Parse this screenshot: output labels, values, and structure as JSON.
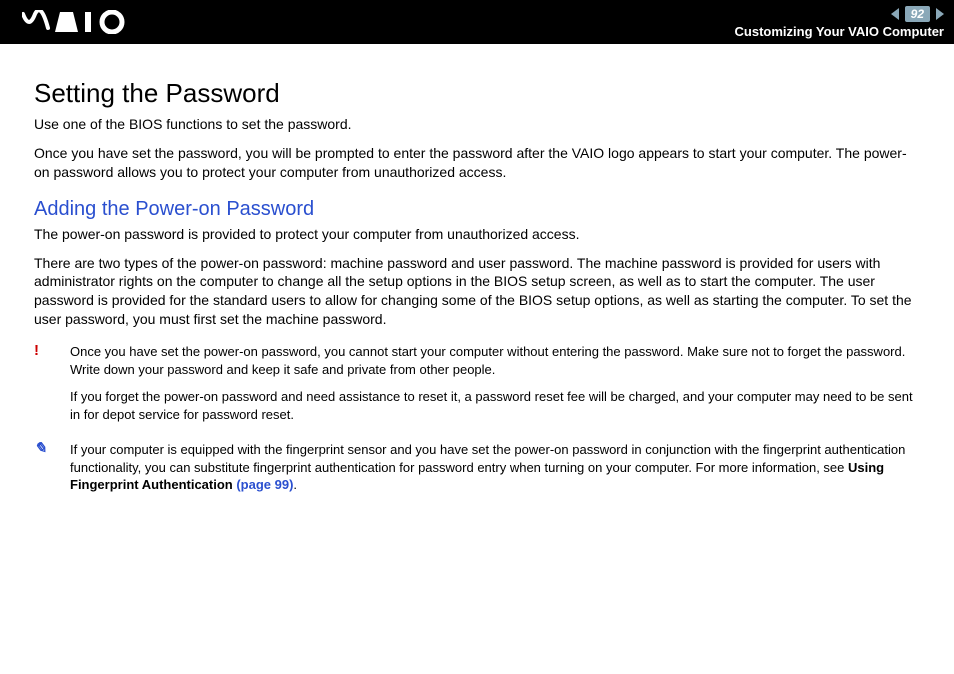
{
  "header": {
    "page_number": "92",
    "breadcrumb": "Customizing Your VAIO Computer"
  },
  "main": {
    "h1": "Setting the Password",
    "intro1": "Use one of the BIOS functions to set the password.",
    "intro2": "Once you have set the password, you will be prompted to enter the password after the VAIO logo appears to start your computer. The power-on password allows you to protect your computer from unauthorized access.",
    "h2": "Adding the Power-on Password",
    "p1": "The power-on password is provided to protect your computer from unauthorized access.",
    "p2": "There are two types of the power-on password: machine password and user password. The machine password is provided for users with administrator rights on the computer to change all the setup options in the BIOS setup screen, as well as to start the computer. The user password is provided for the standard users to allow for changing some of the BIOS setup options, as well as starting the computer. To set the user password, you must first set the machine password.",
    "warning_glyph": "!",
    "warning1": "Once you have set the power-on password, you cannot start your computer without entering the password. Make sure not to forget the password. Write down your password and keep it safe and private from other people.",
    "warning2": "If you forget the power-on password and need assistance to reset it, a password reset fee will be charged, and your computer may need to be sent in for depot service for password reset.",
    "tip_glyph": "✎",
    "tip_pre": "If your computer is equipped with the fingerprint sensor and you have set the power-on password in conjunction with the fingerprint authentication functionality, you can substitute fingerprint authentication for password entry when turning on your computer. For more information, see ",
    "tip_bold": "Using Fingerprint Authentication",
    "tip_link": " (page 99)",
    "tip_post": "."
  }
}
